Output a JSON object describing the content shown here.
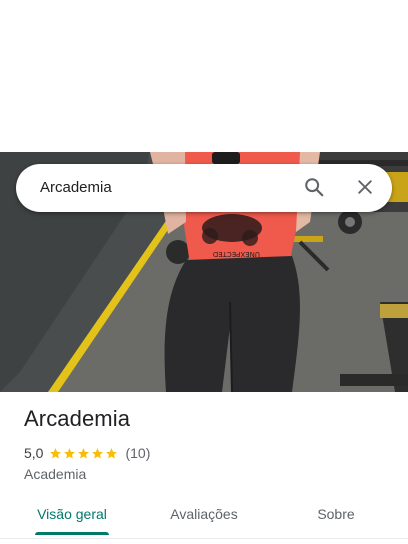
{
  "search": {
    "value": "Arcademia",
    "search_icon": "search-icon",
    "close_icon": "close-icon"
  },
  "photo": {
    "shirt_print": "UNEXPECTED"
  },
  "place": {
    "name": "Arcademia",
    "rating": "5,0",
    "stars": 5,
    "review_count": "(10)",
    "category": "Academia"
  },
  "tabs": [
    {
      "label": "Visão geral",
      "active": true
    },
    {
      "label": "Avaliações",
      "active": false
    },
    {
      "label": "Sobre",
      "active": false
    }
  ],
  "colors": {
    "accent": "#00796b",
    "star": "#fbbc04",
    "text_primary": "#202124",
    "text_secondary": "#5f6368"
  }
}
